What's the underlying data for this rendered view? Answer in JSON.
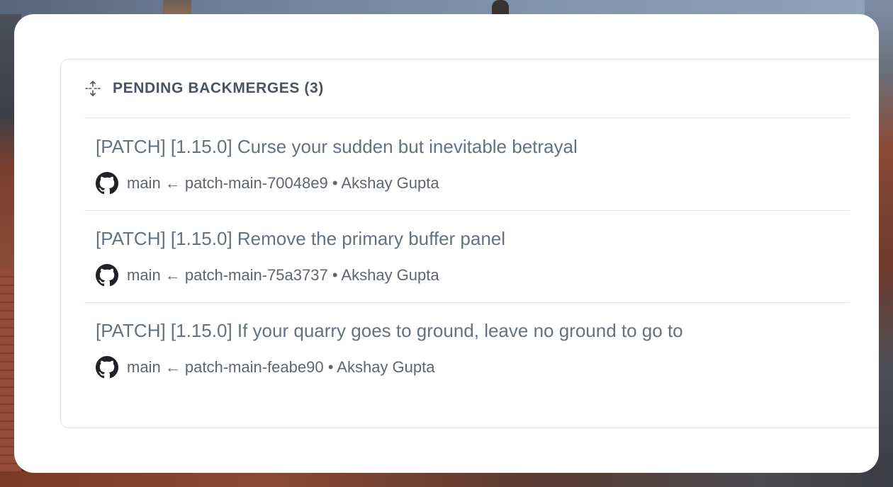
{
  "panel": {
    "title": "PENDING BACKMERGES (3)",
    "icon": "merge-vertical-icon"
  },
  "items": [
    {
      "title": "[PATCH] [1.15.0] Curse your sudden but inevitable betrayal",
      "meta": "main ← patch-main-70048e9 • Akshay Gupta",
      "icon": "github-icon"
    },
    {
      "title": "[PATCH] [1.15.0] Remove the primary buffer panel",
      "meta": "main ← patch-main-75a3737 • Akshay Gupta",
      "icon": "github-icon"
    },
    {
      "title": "[PATCH] [1.15.0] If your quarry goes to ground, leave no ground to go to",
      "meta": "main ← patch-main-feabe90 • Akshay Gupta",
      "icon": "github-icon"
    }
  ],
  "colors": {
    "title_text": "#667085",
    "header_text": "#4a5364",
    "meta_text": "#5f6570",
    "divider": "#e3e5e9"
  }
}
